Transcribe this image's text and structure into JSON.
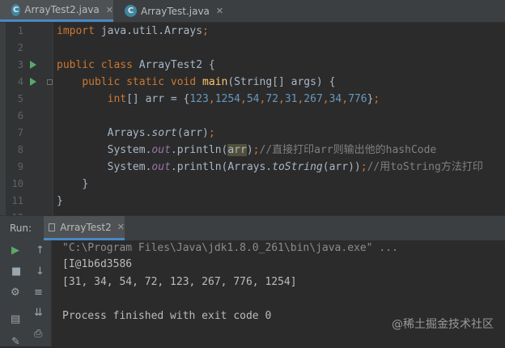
{
  "tabs": [
    {
      "icon": "C",
      "label": "ArrayTest2.java",
      "active": true
    },
    {
      "icon": "C",
      "label": "ArrayTest.java",
      "active": false
    }
  ],
  "gutter": {
    "line_numbers": [
      "1",
      "2",
      "3",
      "4",
      "5",
      "6",
      "7",
      "8",
      "9",
      "10",
      "11",
      "12"
    ]
  },
  "code": {
    "l1_kw": "import",
    "l1_rest": " java.util.Arrays",
    "l1_semi": ";",
    "l3_kw1": "public",
    "l3_kw2": "class",
    "l3_name": "ArrayTest2 {",
    "l4_kw1": "public",
    "l4_kw2": "static",
    "l4_kw3": "void",
    "l4_fn": "main",
    "l4_rest": "(String[] args) {",
    "l5_kw": "int",
    "l5_mid": "[] arr = {",
    "l5_nums": [
      "123",
      "1254",
      "54",
      "72",
      "31",
      "267",
      "34",
      "776"
    ],
    "l5_end": "}",
    "l7_a": "Arrays.",
    "l7_fn": "sort",
    "l7_b": "(arr)",
    "l8_a": "System.",
    "l8_field": "out",
    "l8_b": ".println(",
    "l8_arg": "arr",
    "l8_c": ")",
    "l8_cmt": "//直接打印arr则输出他的hashCode",
    "l9_a": "System.",
    "l9_field": "out",
    "l9_b": ".println(Arrays.",
    "l9_it": "toString",
    "l9_c": "(arr))",
    "l9_cmt": "//用toString方法打印",
    "l10": "}",
    "l11": "}"
  },
  "run": {
    "label": "Run:",
    "tab_label": "ArrayTest2"
  },
  "console": {
    "lines": [
      "\"C:\\Program Files\\Java\\jdk1.8.0_261\\bin\\java.exe\" ...",
      "[I@1b6d3586",
      "[31, 34, 54, 72, 123, 267, 776, 1254]",
      "",
      "Process finished with exit code 0"
    ]
  },
  "watermark": "@稀土掘金技术社区"
}
